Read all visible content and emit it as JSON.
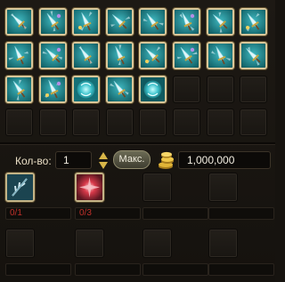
{
  "inventory": {
    "items": [
      {
        "icon": "blade-weapon-icon",
        "bg": "#0f5d62"
      },
      {
        "icon": "dagger-weapon-icon",
        "bg": "#0e5a5e"
      },
      {
        "icon": "sword-weapon-icon",
        "bg": "#10646a"
      },
      {
        "icon": "scythe-weapon-icon",
        "bg": "#0d5359"
      },
      {
        "icon": "claw-weapon-icon",
        "bg": "#0f5b61"
      },
      {
        "icon": "staff-weapon-icon",
        "bg": "#135f67"
      },
      {
        "icon": "spear-weapon-icon",
        "bg": "#0e5a60"
      },
      {
        "icon": "axe-weapon-icon",
        "bg": "#0f5d62"
      },
      {
        "icon": "dual-blade-weapon-icon",
        "bg": "#0f5d62"
      },
      {
        "icon": "trident-weapon-icon",
        "bg": "#105f65"
      },
      {
        "icon": "bow-weapon-icon",
        "bg": "#0e585e"
      },
      {
        "icon": "gauntlet-weapon-icon",
        "bg": "#105c62"
      },
      {
        "icon": "greatsword-weapon-icon",
        "bg": "#0f5a60"
      },
      {
        "icon": "halberd-weapon-icon",
        "bg": "#0e5b61"
      },
      {
        "icon": "wing-weapon-icon",
        "bg": "#105f65"
      },
      {
        "icon": "lance-weapon-icon",
        "bg": "#0f5d62"
      },
      {
        "icon": "cannon-weapon-icon",
        "bg": "#0f5d62"
      },
      {
        "icon": "hammer-weapon-icon",
        "bg": "#0e5a60"
      },
      {
        "icon": "orb-weapon-icon",
        "bg": "#147077"
      },
      {
        "icon": "crossbow-weapon-icon",
        "bg": "#0f5d62"
      },
      {
        "icon": "crystal-weapon-icon",
        "bg": "#0f5a60"
      }
    ]
  },
  "quantity": {
    "label": "Кол-во:",
    "value": "1",
    "max_label": "Макс.",
    "price": "1,000,000"
  },
  "materials": [
    {
      "icon": "feather-material-icon",
      "count": "0/1",
      "bg": "#1b4450"
    },
    {
      "icon": "red-crystal-material-icon",
      "count": "0/3",
      "bg": "#5a1720"
    },
    {
      "icon": "",
      "count": ""
    },
    {
      "icon": "",
      "count": ""
    }
  ]
}
